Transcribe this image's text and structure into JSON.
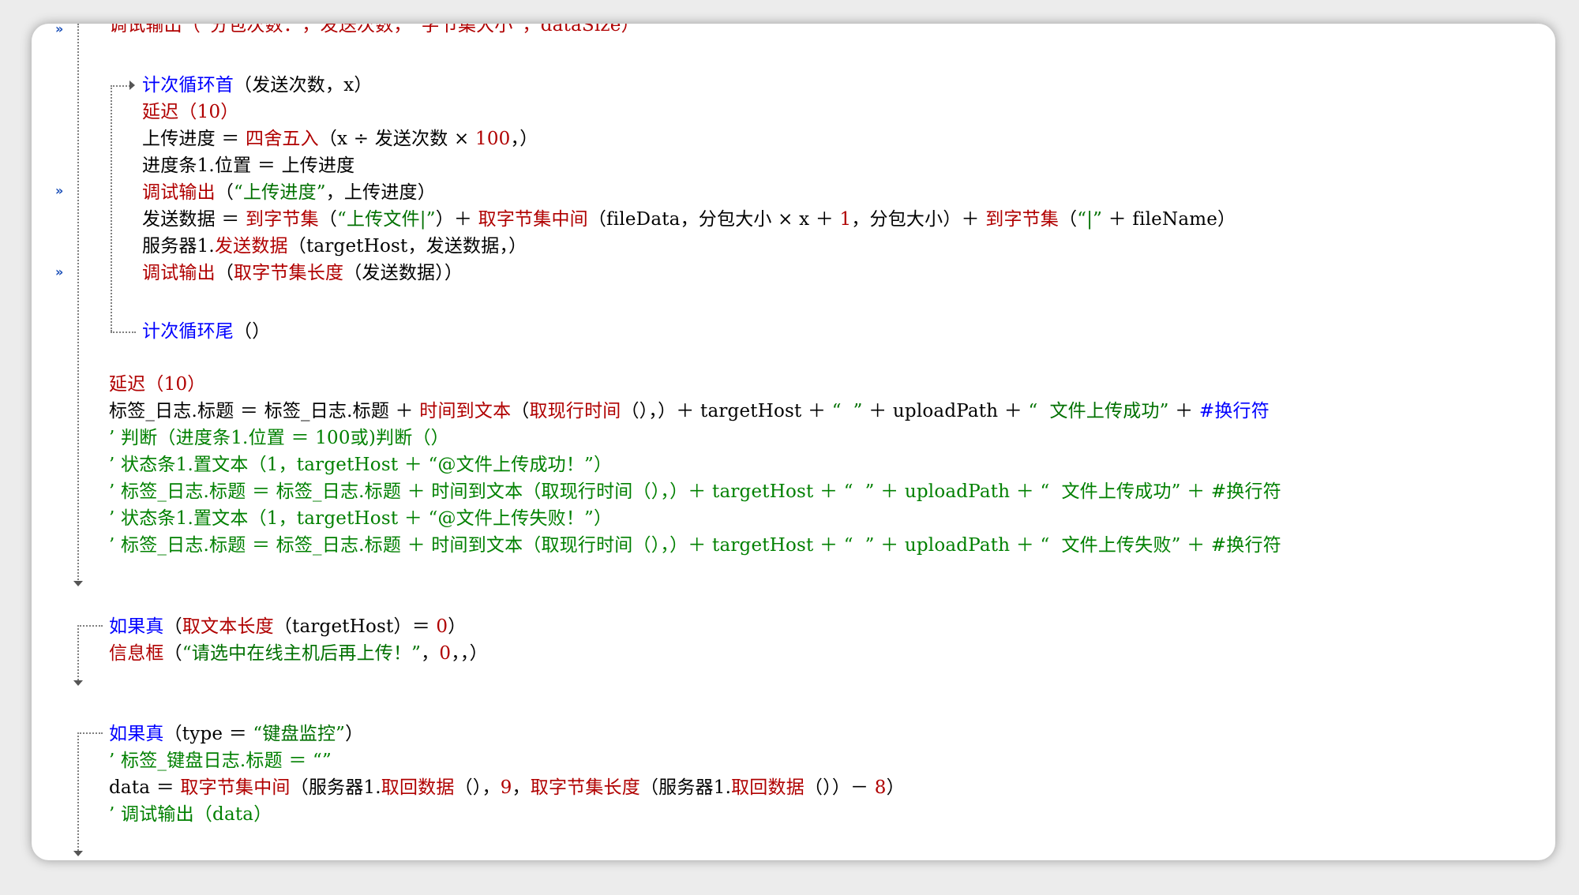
{
  "editor": {
    "lines": [
      {
        "id": "l0",
        "segments": [
          {
            "t": "调试输出（“分包次数：”，发送次数，“字节集大小”，dataSize）",
            "c": "red"
          }
        ]
      },
      {
        "id": "l1",
        "segments": [
          {
            "t": "计次循环首",
            "c": "blu"
          },
          {
            "t": "（发送次数，x）",
            "c": "blk"
          }
        ]
      },
      {
        "id": "l2",
        "segments": [
          {
            "t": "延迟",
            "c": "red"
          },
          {
            "t": "（10）",
            "c": "red"
          }
        ]
      },
      {
        "id": "l3",
        "segments": [
          {
            "t": "上传进度 ＝ ",
            "c": "blk"
          },
          {
            "t": "四舍五入",
            "c": "red"
          },
          {
            "t": "（x ÷ 发送次数 × ",
            "c": "blk"
          },
          {
            "t": "100",
            "c": "red"
          },
          {
            "t": "，）",
            "c": "blk"
          }
        ]
      },
      {
        "id": "l4",
        "segments": [
          {
            "t": "进度条1.位置 ＝ 上传进度",
            "c": "blk"
          }
        ]
      },
      {
        "id": "l5",
        "segments": [
          {
            "t": "调试输出",
            "c": "red"
          },
          {
            "t": "（",
            "c": "blk"
          },
          {
            "t": "“上传进度”",
            "c": "grn"
          },
          {
            "t": "，上传进度）",
            "c": "blk"
          }
        ]
      },
      {
        "id": "l6",
        "segments": [
          {
            "t": "发送数据 ＝ ",
            "c": "blk"
          },
          {
            "t": "到字节集",
            "c": "red"
          },
          {
            "t": "（",
            "c": "blk"
          },
          {
            "t": "“上传文件|”",
            "c": "grn"
          },
          {
            "t": "）＋ ",
            "c": "blk"
          },
          {
            "t": "取字节集中间",
            "c": "red"
          },
          {
            "t": "（fileData，分包大小 × x ＋ ",
            "c": "blk"
          },
          {
            "t": "1",
            "c": "red"
          },
          {
            "t": "，分包大小）＋ ",
            "c": "blk"
          },
          {
            "t": "到字节集",
            "c": "red"
          },
          {
            "t": "（",
            "c": "blk"
          },
          {
            "t": "“|”",
            "c": "grn"
          },
          {
            "t": " ＋ fileName）",
            "c": "blk"
          }
        ]
      },
      {
        "id": "l7",
        "segments": [
          {
            "t": "服务器1.",
            "c": "blk"
          },
          {
            "t": "发送数据",
            "c": "red"
          },
          {
            "t": "（targetHost，发送数据，）",
            "c": "blk"
          }
        ]
      },
      {
        "id": "l8",
        "segments": [
          {
            "t": "调试输出",
            "c": "red"
          },
          {
            "t": "（",
            "c": "blk"
          },
          {
            "t": "取字节集长度",
            "c": "red"
          },
          {
            "t": "（发送数据））",
            "c": "blk"
          }
        ]
      },
      {
        "id": "l9",
        "segments": [
          {
            "t": "计次循环尾",
            "c": "blu"
          },
          {
            "t": "（）",
            "c": "blk"
          }
        ]
      },
      {
        "id": "l10",
        "segments": [
          {
            "t": "延迟",
            "c": "red"
          },
          {
            "t": "（10）",
            "c": "red"
          }
        ]
      },
      {
        "id": "l11",
        "segments": [
          {
            "t": "标签_日志.标题 ＝ 标签_日志.标题 ＋ ",
            "c": "blk"
          },
          {
            "t": "时间到文本",
            "c": "red"
          },
          {
            "t": "（",
            "c": "blk"
          },
          {
            "t": "取现行时间",
            "c": "red"
          },
          {
            "t": "（），）＋ targetHost ＋ ",
            "c": "blk"
          },
          {
            "t": "“  ”",
            "c": "grn"
          },
          {
            "t": " ＋ uploadPath ＋ ",
            "c": "blk"
          },
          {
            "t": "“  文件上传成功”",
            "c": "grn"
          },
          {
            "t": " ＋ ",
            "c": "blk"
          },
          {
            "t": "#换行符",
            "c": "blu"
          }
        ]
      },
      {
        "id": "l12",
        "segments": [
          {
            "t": "’ 判断（进度条1.位置 ＝ 100或)判断（）",
            "c": "cmt"
          }
        ]
      },
      {
        "id": "l13",
        "segments": [
          {
            "t": "’ 状态条1.置文本（1，targetHost ＋ “@文件上传成功！”）",
            "c": "cmt"
          }
        ]
      },
      {
        "id": "l14",
        "segments": [
          {
            "t": "’ 标签_日志.标题 ＝ 标签_日志.标题 ＋ 时间到文本（取现行时间（），）＋ targetHost ＋ “  ” ＋ uploadPath ＋ “  文件上传成功” ＋ #换行符",
            "c": "cmt"
          }
        ]
      },
      {
        "id": "l15",
        "segments": [
          {
            "t": "’ 状态条1.置文本（1，targetHost ＋ “@文件上传失败！”）",
            "c": "cmt"
          }
        ]
      },
      {
        "id": "l16",
        "segments": [
          {
            "t": "’ 标签_日志.标题 ＝ 标签_日志.标题 ＋ 时间到文本（取现行时间（），）＋ targetHost ＋ “  ” ＋ uploadPath ＋ “  文件上传失败” ＋ #换行符",
            "c": "cmt"
          }
        ]
      },
      {
        "id": "l17",
        "segments": [
          {
            "t": "如果真",
            "c": "blu"
          },
          {
            "t": "（",
            "c": "blk"
          },
          {
            "t": "取文本长度",
            "c": "red"
          },
          {
            "t": "（targetHost）＝ ",
            "c": "blk"
          },
          {
            "t": "0",
            "c": "red"
          },
          {
            "t": "）",
            "c": "blk"
          }
        ]
      },
      {
        "id": "l18",
        "segments": [
          {
            "t": "信息框",
            "c": "red"
          },
          {
            "t": "（",
            "c": "blk"
          },
          {
            "t": "“请选中在线主机后再上传！”",
            "c": "grn"
          },
          {
            "t": "，",
            "c": "blk"
          },
          {
            "t": "0",
            "c": "red"
          },
          {
            "t": "，，）",
            "c": "blk"
          }
        ]
      },
      {
        "id": "l19",
        "segments": [
          {
            "t": "如果真",
            "c": "blu"
          },
          {
            "t": "（type ＝ ",
            "c": "blk"
          },
          {
            "t": "“键盘监控”",
            "c": "grn"
          },
          {
            "t": "）",
            "c": "blk"
          }
        ]
      },
      {
        "id": "l20",
        "segments": [
          {
            "t": "’ 标签_键盘日志.标题 ＝ “”",
            "c": "cmt"
          }
        ]
      },
      {
        "id": "l21",
        "segments": [
          {
            "t": "data ＝ ",
            "c": "blk"
          },
          {
            "t": "取字节集中间",
            "c": "red"
          },
          {
            "t": "（服务器1.",
            "c": "blk"
          },
          {
            "t": "取回数据",
            "c": "red"
          },
          {
            "t": "（），",
            "c": "blk"
          },
          {
            "t": "9",
            "c": "red"
          },
          {
            "t": "，",
            "c": "blk"
          },
          {
            "t": "取字节集长度",
            "c": "red"
          },
          {
            "t": "（服务器1.",
            "c": "blk"
          },
          {
            "t": "取回数据",
            "c": "red"
          },
          {
            "t": "（））－ ",
            "c": "blk"
          },
          {
            "t": "8",
            "c": "red"
          },
          {
            "t": "）",
            "c": "blk"
          }
        ]
      },
      {
        "id": "l22",
        "segments": [
          {
            "t": "’ 调试输出（data）",
            "c": "cmt"
          }
        ]
      }
    ]
  },
  "breakpoint_glyph": "»"
}
